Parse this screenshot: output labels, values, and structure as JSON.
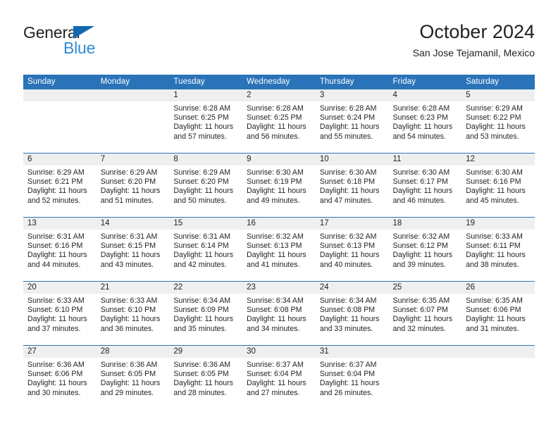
{
  "brand": {
    "name_part1": "General",
    "name_part2": "Blue",
    "triangle_color": "#1267b1",
    "blue_text_color": "#2e8bd4"
  },
  "header": {
    "title": "October 2024",
    "subtitle": "San Jose Tejamanil, Mexico"
  },
  "theme": {
    "header_blue": "#2a73b8",
    "daynum_band": "#efefef",
    "text": "#231f20"
  },
  "calendar": {
    "weekday_headers": [
      "Sunday",
      "Monday",
      "Tuesday",
      "Wednesday",
      "Thursday",
      "Friday",
      "Saturday"
    ],
    "weeks": [
      [
        {
          "day": "",
          "lines": []
        },
        {
          "day": "",
          "lines": []
        },
        {
          "day": "1",
          "lines": [
            "Sunrise: 6:28 AM",
            "Sunset: 6:25 PM",
            "Daylight: 11 hours",
            "and 57 minutes."
          ]
        },
        {
          "day": "2",
          "lines": [
            "Sunrise: 6:28 AM",
            "Sunset: 6:25 PM",
            "Daylight: 11 hours",
            "and 56 minutes."
          ]
        },
        {
          "day": "3",
          "lines": [
            "Sunrise: 6:28 AM",
            "Sunset: 6:24 PM",
            "Daylight: 11 hours",
            "and 55 minutes."
          ]
        },
        {
          "day": "4",
          "lines": [
            "Sunrise: 6:28 AM",
            "Sunset: 6:23 PM",
            "Daylight: 11 hours",
            "and 54 minutes."
          ]
        },
        {
          "day": "5",
          "lines": [
            "Sunrise: 6:29 AM",
            "Sunset: 6:22 PM",
            "Daylight: 11 hours",
            "and 53 minutes."
          ]
        }
      ],
      [
        {
          "day": "6",
          "lines": [
            "Sunrise: 6:29 AM",
            "Sunset: 6:21 PM",
            "Daylight: 11 hours",
            "and 52 minutes."
          ]
        },
        {
          "day": "7",
          "lines": [
            "Sunrise: 6:29 AM",
            "Sunset: 6:20 PM",
            "Daylight: 11 hours",
            "and 51 minutes."
          ]
        },
        {
          "day": "8",
          "lines": [
            "Sunrise: 6:29 AM",
            "Sunset: 6:20 PM",
            "Daylight: 11 hours",
            "and 50 minutes."
          ]
        },
        {
          "day": "9",
          "lines": [
            "Sunrise: 6:30 AM",
            "Sunset: 6:19 PM",
            "Daylight: 11 hours",
            "and 49 minutes."
          ]
        },
        {
          "day": "10",
          "lines": [
            "Sunrise: 6:30 AM",
            "Sunset: 6:18 PM",
            "Daylight: 11 hours",
            "and 47 minutes."
          ]
        },
        {
          "day": "11",
          "lines": [
            "Sunrise: 6:30 AM",
            "Sunset: 6:17 PM",
            "Daylight: 11 hours",
            "and 46 minutes."
          ]
        },
        {
          "day": "12",
          "lines": [
            "Sunrise: 6:30 AM",
            "Sunset: 6:16 PM",
            "Daylight: 11 hours",
            "and 45 minutes."
          ]
        }
      ],
      [
        {
          "day": "13",
          "lines": [
            "Sunrise: 6:31 AM",
            "Sunset: 6:16 PM",
            "Daylight: 11 hours",
            "and 44 minutes."
          ]
        },
        {
          "day": "14",
          "lines": [
            "Sunrise: 6:31 AM",
            "Sunset: 6:15 PM",
            "Daylight: 11 hours",
            "and 43 minutes."
          ]
        },
        {
          "day": "15",
          "lines": [
            "Sunrise: 6:31 AM",
            "Sunset: 6:14 PM",
            "Daylight: 11 hours",
            "and 42 minutes."
          ]
        },
        {
          "day": "16",
          "lines": [
            "Sunrise: 6:32 AM",
            "Sunset: 6:13 PM",
            "Daylight: 11 hours",
            "and 41 minutes."
          ]
        },
        {
          "day": "17",
          "lines": [
            "Sunrise: 6:32 AM",
            "Sunset: 6:13 PM",
            "Daylight: 11 hours",
            "and 40 minutes."
          ]
        },
        {
          "day": "18",
          "lines": [
            "Sunrise: 6:32 AM",
            "Sunset: 6:12 PM",
            "Daylight: 11 hours",
            "and 39 minutes."
          ]
        },
        {
          "day": "19",
          "lines": [
            "Sunrise: 6:33 AM",
            "Sunset: 6:11 PM",
            "Daylight: 11 hours",
            "and 38 minutes."
          ]
        }
      ],
      [
        {
          "day": "20",
          "lines": [
            "Sunrise: 6:33 AM",
            "Sunset: 6:10 PM",
            "Daylight: 11 hours",
            "and 37 minutes."
          ]
        },
        {
          "day": "21",
          "lines": [
            "Sunrise: 6:33 AM",
            "Sunset: 6:10 PM",
            "Daylight: 11 hours",
            "and 36 minutes."
          ]
        },
        {
          "day": "22",
          "lines": [
            "Sunrise: 6:34 AM",
            "Sunset: 6:09 PM",
            "Daylight: 11 hours",
            "and 35 minutes."
          ]
        },
        {
          "day": "23",
          "lines": [
            "Sunrise: 6:34 AM",
            "Sunset: 6:08 PM",
            "Daylight: 11 hours",
            "and 34 minutes."
          ]
        },
        {
          "day": "24",
          "lines": [
            "Sunrise: 6:34 AM",
            "Sunset: 6:08 PM",
            "Daylight: 11 hours",
            "and 33 minutes."
          ]
        },
        {
          "day": "25",
          "lines": [
            "Sunrise: 6:35 AM",
            "Sunset: 6:07 PM",
            "Daylight: 11 hours",
            "and 32 minutes."
          ]
        },
        {
          "day": "26",
          "lines": [
            "Sunrise: 6:35 AM",
            "Sunset: 6:06 PM",
            "Daylight: 11 hours",
            "and 31 minutes."
          ]
        }
      ],
      [
        {
          "day": "27",
          "lines": [
            "Sunrise: 6:36 AM",
            "Sunset: 6:06 PM",
            "Daylight: 11 hours",
            "and 30 minutes."
          ]
        },
        {
          "day": "28",
          "lines": [
            "Sunrise: 6:36 AM",
            "Sunset: 6:05 PM",
            "Daylight: 11 hours",
            "and 29 minutes."
          ]
        },
        {
          "day": "29",
          "lines": [
            "Sunrise: 6:36 AM",
            "Sunset: 6:05 PM",
            "Daylight: 11 hours",
            "and 28 minutes."
          ]
        },
        {
          "day": "30",
          "lines": [
            "Sunrise: 6:37 AM",
            "Sunset: 6:04 PM",
            "Daylight: 11 hours",
            "and 27 minutes."
          ]
        },
        {
          "day": "31",
          "lines": [
            "Sunrise: 6:37 AM",
            "Sunset: 6:04 PM",
            "Daylight: 11 hours",
            "and 26 minutes."
          ]
        },
        {
          "day": "",
          "lines": []
        },
        {
          "day": "",
          "lines": []
        }
      ]
    ]
  }
}
